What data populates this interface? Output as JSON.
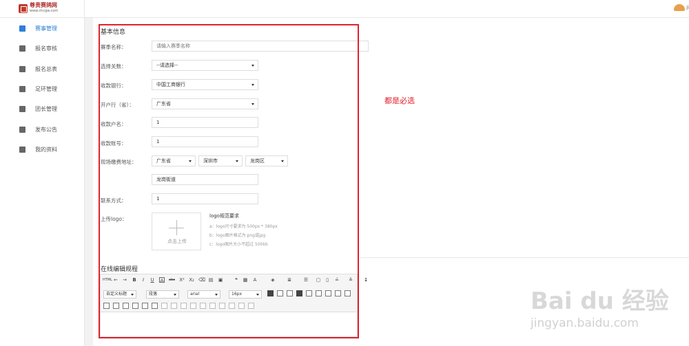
{
  "brand": {
    "name": "尊贵赛鸽网",
    "url": "www.chcgw.com"
  },
  "user": {
    "name": "ji"
  },
  "sidebar": {
    "items": [
      {
        "label": "赛事管理",
        "icon": "trophy-icon",
        "active": true
      },
      {
        "label": "报名审核",
        "icon": "document-icon",
        "active": false
      },
      {
        "label": "报名总表",
        "icon": "list-card-icon",
        "active": false
      },
      {
        "label": "足环管理",
        "icon": "tag-icon",
        "active": false
      },
      {
        "label": "团长管理",
        "icon": "person-icon",
        "active": false
      },
      {
        "label": "发布公告",
        "icon": "send-icon",
        "active": false
      },
      {
        "label": "我的资料",
        "icon": "profile-card-icon",
        "active": false
      }
    ]
  },
  "form": {
    "section_title": "基本信息",
    "fields": {
      "name": {
        "label": "赛季名称：",
        "placeholder": "请输入赛季名称"
      },
      "level": {
        "label": "选择关数：",
        "value": "--请选择--"
      },
      "bank": {
        "label": "收款银行：",
        "value": "中国工商银行"
      },
      "branch": {
        "label": "开户行（省）：",
        "value": "广东省"
      },
      "payee": {
        "label": "收款户名：",
        "value": "1"
      },
      "account": {
        "label": "收款账号：",
        "value": "1"
      },
      "address": {
        "label": "现场缴费地址：",
        "province": "广东省",
        "city": "深圳市",
        "district": "龙岗区",
        "street": "龙岗街道"
      },
      "contact": {
        "label": "联系方式：",
        "value": "1"
      },
      "logo": {
        "label": "上传logo：",
        "upload_text": "点击上传"
      }
    },
    "logo_requirements": {
      "title": "logo规范要求",
      "items": [
        "a：logo尺寸要求为 500px * 380px",
        "b：logo图片格式为 png或jpg",
        "c：logo图片大小不超过 500kb"
      ]
    }
  },
  "editor": {
    "section_title": "在线编辑规程",
    "font_style": "自定义标题",
    "paragraph": "段落",
    "font_family": "arial",
    "font_size": "16px"
  },
  "annotation": {
    "text": "都是必选",
    "color": "#e0202a"
  },
  "watermark": {
    "logo": "Bai du 经验",
    "url": "jingyan.baidu.com"
  },
  "colors": {
    "accent": "#2d7fd8",
    "highlight": "#e0202a"
  }
}
